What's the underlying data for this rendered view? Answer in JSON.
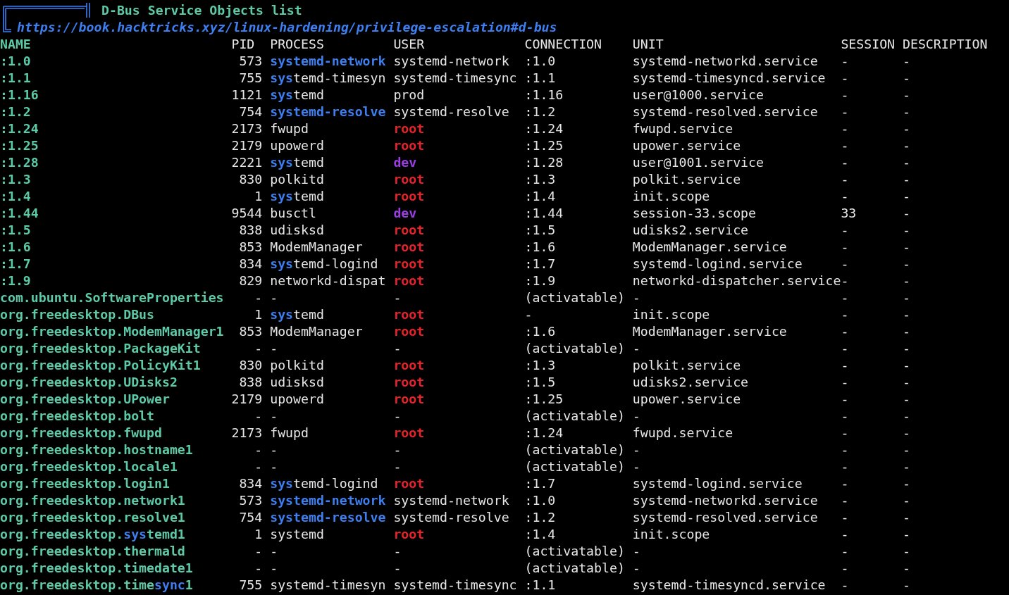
{
  "header": {
    "title": "D-Bus Service Objects list",
    "link": "https://book.hacktricks.xyz/linux-hardening/privilege-escalation#d-bus"
  },
  "table": {
    "columns": [
      {
        "label": "NAME",
        "kind": "key"
      },
      {
        "label": "PID",
        "kind": "num"
      },
      {
        "label": "PROCESS",
        "kind": "text"
      },
      {
        "label": "USER",
        "kind": "text"
      },
      {
        "label": "CONNECTION",
        "kind": "text"
      },
      {
        "label": "UNIT",
        "kind": "text"
      },
      {
        "label": "SESSION",
        "kind": "text"
      },
      {
        "label": "DESCRIPTION",
        "kind": "text"
      }
    ],
    "rows": [
      {
        "name": [
          {
            "text": ":1.0",
            "highlight": false
          }
        ],
        "pid": "573",
        "process": [
          {
            "text": "systemd-network",
            "highlight": true
          }
        ],
        "user": {
          "text": "systemd-network",
          "kind": "plain"
        },
        "connection": ":1.0",
        "unit": "systemd-networkd.service",
        "session": "-",
        "description": "-"
      },
      {
        "name": [
          {
            "text": ":1.1",
            "highlight": false
          }
        ],
        "pid": "755",
        "process": [
          {
            "text": "sys",
            "highlight": true
          },
          {
            "text": "temd-timesyn",
            "highlight": false
          }
        ],
        "user": {
          "text": "systemd-timesync",
          "kind": "plain"
        },
        "connection": ":1.1",
        "unit": "systemd-timesyncd.service",
        "session": "-",
        "description": "-"
      },
      {
        "name": [
          {
            "text": ":1.16",
            "highlight": false
          }
        ],
        "pid": "1121",
        "process": [
          {
            "text": "sys",
            "highlight": true
          },
          {
            "text": "temd",
            "highlight": false
          }
        ],
        "user": {
          "text": "prod",
          "kind": "plain"
        },
        "connection": ":1.16",
        "unit": "user@1000.service",
        "session": "-",
        "description": "-"
      },
      {
        "name": [
          {
            "text": ":1.2",
            "highlight": false
          }
        ],
        "pid": "754",
        "process": [
          {
            "text": "systemd-resolve",
            "highlight": true
          }
        ],
        "user": {
          "text": "systemd-resolve",
          "kind": "plain"
        },
        "connection": ":1.2",
        "unit": "systemd-resolved.service",
        "session": "-",
        "description": "-"
      },
      {
        "name": [
          {
            "text": ":1.24",
            "highlight": false
          }
        ],
        "pid": "2173",
        "process": [
          {
            "text": "fwupd",
            "highlight": false
          }
        ],
        "user": {
          "text": "root",
          "kind": "root"
        },
        "connection": ":1.24",
        "unit": "fwupd.service",
        "session": "-",
        "description": "-"
      },
      {
        "name": [
          {
            "text": ":1.25",
            "highlight": false
          }
        ],
        "pid": "2179",
        "process": [
          {
            "text": "upowerd",
            "highlight": false
          }
        ],
        "user": {
          "text": "root",
          "kind": "root"
        },
        "connection": ":1.25",
        "unit": "upower.service",
        "session": "-",
        "description": "-"
      },
      {
        "name": [
          {
            "text": ":1.28",
            "highlight": false
          }
        ],
        "pid": "2221",
        "process": [
          {
            "text": "sys",
            "highlight": true
          },
          {
            "text": "temd",
            "highlight": false
          }
        ],
        "user": {
          "text": "dev",
          "kind": "dev"
        },
        "connection": ":1.28",
        "unit": "user@1001.service",
        "session": "-",
        "description": "-"
      },
      {
        "name": [
          {
            "text": ":1.3",
            "highlight": false
          }
        ],
        "pid": "830",
        "process": [
          {
            "text": "polkitd",
            "highlight": false
          }
        ],
        "user": {
          "text": "root",
          "kind": "root"
        },
        "connection": ":1.3",
        "unit": "polkit.service",
        "session": "-",
        "description": "-"
      },
      {
        "name": [
          {
            "text": ":1.4",
            "highlight": false
          }
        ],
        "pid": "1",
        "process": [
          {
            "text": "sys",
            "highlight": true
          },
          {
            "text": "temd",
            "highlight": false
          }
        ],
        "user": {
          "text": "root",
          "kind": "root"
        },
        "connection": ":1.4",
        "unit": "init.scope",
        "session": "-",
        "description": "-"
      },
      {
        "name": [
          {
            "text": ":1.44",
            "highlight": false
          }
        ],
        "pid": "9544",
        "process": [
          {
            "text": "busctl",
            "highlight": false
          }
        ],
        "user": {
          "text": "dev",
          "kind": "dev"
        },
        "connection": ":1.44",
        "unit": "session-33.scope",
        "session": "33",
        "description": "-"
      },
      {
        "name": [
          {
            "text": ":1.5",
            "highlight": false
          }
        ],
        "pid": "838",
        "process": [
          {
            "text": "udisksd",
            "highlight": false
          }
        ],
        "user": {
          "text": "root",
          "kind": "root"
        },
        "connection": ":1.5",
        "unit": "udisks2.service",
        "session": "-",
        "description": "-"
      },
      {
        "name": [
          {
            "text": ":1.6",
            "highlight": false
          }
        ],
        "pid": "853",
        "process": [
          {
            "text": "ModemManager",
            "highlight": false
          }
        ],
        "user": {
          "text": "root",
          "kind": "root"
        },
        "connection": ":1.6",
        "unit": "ModemManager.service",
        "session": "-",
        "description": "-"
      },
      {
        "name": [
          {
            "text": ":1.7",
            "highlight": false
          }
        ],
        "pid": "834",
        "process": [
          {
            "text": "sys",
            "highlight": true
          },
          {
            "text": "temd-logind",
            "highlight": false
          }
        ],
        "user": {
          "text": "root",
          "kind": "root"
        },
        "connection": ":1.7",
        "unit": "systemd-logind.service",
        "session": "-",
        "description": "-"
      },
      {
        "name": [
          {
            "text": ":1.9",
            "highlight": false
          }
        ],
        "pid": "829",
        "process": [
          {
            "text": "networkd-dispat",
            "highlight": false
          }
        ],
        "user": {
          "text": "root",
          "kind": "root"
        },
        "connection": ":1.9",
        "unit": "networkd-dispatcher.service",
        "session": "-",
        "description": "-"
      },
      {
        "name": [
          {
            "text": "com.ubuntu.SoftwareProperties",
            "highlight": false
          }
        ],
        "pid": "-",
        "process": [
          {
            "text": "-",
            "highlight": false
          }
        ],
        "user": {
          "text": "-",
          "kind": "plain"
        },
        "connection": "(activatable)",
        "unit": "-",
        "session": "-",
        "description": "-"
      },
      {
        "name": [
          {
            "text": "org.freedesktop.DBus",
            "highlight": false
          }
        ],
        "pid": "1",
        "process": [
          {
            "text": "sys",
            "highlight": true
          },
          {
            "text": "temd",
            "highlight": false
          }
        ],
        "user": {
          "text": "root",
          "kind": "root"
        },
        "connection": "-",
        "unit": "init.scope",
        "session": "-",
        "description": "-"
      },
      {
        "name": [
          {
            "text": "org.freedesktop.ModemManager1",
            "highlight": false
          }
        ],
        "pid": "853",
        "process": [
          {
            "text": "ModemManager",
            "highlight": false
          }
        ],
        "user": {
          "text": "root",
          "kind": "root"
        },
        "connection": ":1.6",
        "unit": "ModemManager.service",
        "session": "-",
        "description": "-"
      },
      {
        "name": [
          {
            "text": "org.freedesktop.PackageKit",
            "highlight": false
          }
        ],
        "pid": "-",
        "process": [
          {
            "text": "-",
            "highlight": false
          }
        ],
        "user": {
          "text": "-",
          "kind": "plain"
        },
        "connection": "(activatable)",
        "unit": "-",
        "session": "-",
        "description": "-"
      },
      {
        "name": [
          {
            "text": "org.freedesktop.PolicyKit1",
            "highlight": false
          }
        ],
        "pid": "830",
        "process": [
          {
            "text": "polkitd",
            "highlight": false
          }
        ],
        "user": {
          "text": "root",
          "kind": "root"
        },
        "connection": ":1.3",
        "unit": "polkit.service",
        "session": "-",
        "description": "-"
      },
      {
        "name": [
          {
            "text": "org.freedesktop.UDisks2",
            "highlight": false
          }
        ],
        "pid": "838",
        "process": [
          {
            "text": "udisksd",
            "highlight": false
          }
        ],
        "user": {
          "text": "root",
          "kind": "root"
        },
        "connection": ":1.5",
        "unit": "udisks2.service",
        "session": "-",
        "description": "-"
      },
      {
        "name": [
          {
            "text": "org.freedesktop.UPower",
            "highlight": false
          }
        ],
        "pid": "2179",
        "process": [
          {
            "text": "upowerd",
            "highlight": false
          }
        ],
        "user": {
          "text": "root",
          "kind": "root"
        },
        "connection": ":1.25",
        "unit": "upower.service",
        "session": "-",
        "description": "-"
      },
      {
        "name": [
          {
            "text": "org.freedesktop.bolt",
            "highlight": false
          }
        ],
        "pid": "-",
        "process": [
          {
            "text": "-",
            "highlight": false
          }
        ],
        "user": {
          "text": "-",
          "kind": "plain"
        },
        "connection": "(activatable)",
        "unit": "-",
        "session": "-",
        "description": "-"
      },
      {
        "name": [
          {
            "text": "org.freedesktop.fwupd",
            "highlight": false
          }
        ],
        "pid": "2173",
        "process": [
          {
            "text": "fwupd",
            "highlight": false
          }
        ],
        "user": {
          "text": "root",
          "kind": "root"
        },
        "connection": ":1.24",
        "unit": "fwupd.service",
        "session": "-",
        "description": "-"
      },
      {
        "name": [
          {
            "text": "org.freedesktop.hostname1",
            "highlight": false
          }
        ],
        "pid": "-",
        "process": [
          {
            "text": "-",
            "highlight": false
          }
        ],
        "user": {
          "text": "-",
          "kind": "plain"
        },
        "connection": "(activatable)",
        "unit": "-",
        "session": "-",
        "description": "-"
      },
      {
        "name": [
          {
            "text": "org.freedesktop.locale1",
            "highlight": false
          }
        ],
        "pid": "-",
        "process": [
          {
            "text": "-",
            "highlight": false
          }
        ],
        "user": {
          "text": "-",
          "kind": "plain"
        },
        "connection": "(activatable)",
        "unit": "-",
        "session": "-",
        "description": "-"
      },
      {
        "name": [
          {
            "text": "org.freedesktop.login1",
            "highlight": false
          }
        ],
        "pid": "834",
        "process": [
          {
            "text": "sys",
            "highlight": true
          },
          {
            "text": "temd-logind",
            "highlight": false
          }
        ],
        "user": {
          "text": "root",
          "kind": "root"
        },
        "connection": ":1.7",
        "unit": "systemd-logind.service",
        "session": "-",
        "description": "-"
      },
      {
        "name": [
          {
            "text": "org.freedesktop.network1",
            "highlight": false
          }
        ],
        "pid": "573",
        "process": [
          {
            "text": "systemd-network",
            "highlight": true
          }
        ],
        "user": {
          "text": "systemd-network",
          "kind": "plain"
        },
        "connection": ":1.0",
        "unit": "systemd-networkd.service",
        "session": "-",
        "description": "-"
      },
      {
        "name": [
          {
            "text": "org.freedesktop.resolve1",
            "highlight": false
          }
        ],
        "pid": "754",
        "process": [
          {
            "text": "systemd-resolve",
            "highlight": true
          }
        ],
        "user": {
          "text": "systemd-resolve",
          "kind": "plain"
        },
        "connection": ":1.2",
        "unit": "systemd-resolved.service",
        "session": "-",
        "description": "-"
      },
      {
        "name": [
          {
            "text": "org.freedesktop.",
            "highlight": false
          },
          {
            "text": "sys",
            "highlight": true
          },
          {
            "text": "temd1",
            "highlight": false
          }
        ],
        "pid": "1",
        "process": [
          {
            "text": "systemd",
            "highlight": false
          }
        ],
        "user": {
          "text": "root",
          "kind": "root"
        },
        "connection": ":1.4",
        "unit": "init.scope",
        "session": "-",
        "description": "-"
      },
      {
        "name": [
          {
            "text": "org.freedesktop.thermald",
            "highlight": false
          }
        ],
        "pid": "-",
        "process": [
          {
            "text": "-",
            "highlight": false
          }
        ],
        "user": {
          "text": "-",
          "kind": "plain"
        },
        "connection": "(activatable)",
        "unit": "-",
        "session": "-",
        "description": "-"
      },
      {
        "name": [
          {
            "text": "org.freedesktop.timedate1",
            "highlight": false
          }
        ],
        "pid": "-",
        "process": [
          {
            "text": "-",
            "highlight": false
          }
        ],
        "user": {
          "text": "-",
          "kind": "plain"
        },
        "connection": "(activatable)",
        "unit": "-",
        "session": "-",
        "description": "-"
      },
      {
        "name": [
          {
            "text": "org.freedesktop.time",
            "highlight": false
          },
          {
            "text": "sync",
            "highlight": true
          },
          {
            "text": "1",
            "highlight": false
          }
        ],
        "pid": "755",
        "process": [
          {
            "text": "systemd-timesyn",
            "highlight": false
          }
        ],
        "user": {
          "text": "systemd-timesync",
          "kind": "plain"
        },
        "connection": ":1.1",
        "unit": "systemd-timesyncd.service",
        "session": "-",
        "description": "-"
      }
    ]
  }
}
